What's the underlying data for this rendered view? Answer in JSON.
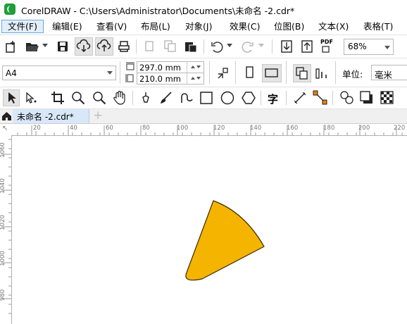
{
  "window": {
    "title": "CorelDRAW - C:\\Users\\Administrator\\Documents\\未命名 -2.cdr*"
  },
  "menu": [
    {
      "label": "文件(F)"
    },
    {
      "label": "编辑(E)"
    },
    {
      "label": "查看(V)"
    },
    {
      "label": "布局(L)"
    },
    {
      "label": "对象(J)"
    },
    {
      "label": "效果(C)"
    },
    {
      "label": "位图(B)"
    },
    {
      "label": "文本(X)"
    },
    {
      "label": "表格(T)"
    }
  ],
  "standard_toolbar": {
    "zoom_value": "68%",
    "pdf_label": "PDF"
  },
  "property_bar": {
    "page_size": "A4",
    "width": "297.0 mm",
    "height": "210.0 mm",
    "units_label": "单位:",
    "units_value": "毫米"
  },
  "toolbox": {
    "text_tool_glyph": "字"
  },
  "tabs": {
    "doc_tab_label": "未命名 -2.cdr*",
    "add_tab": "+"
  },
  "ruler": {
    "h_ticks": [
      "20",
      "40",
      "60",
      "80",
      "100",
      "120",
      "140",
      "160",
      "180",
      "200",
      "220"
    ],
    "v_ticks": [
      "1060",
      "1040",
      "1020",
      "1000",
      "980"
    ],
    "corner": "↖"
  },
  "canvas": {
    "shape": "pie-wedge",
    "fill": "#f5b400",
    "stroke": "#3a2a00"
  },
  "colors": {
    "menu_highlight": "#e3eefb",
    "menu_border": "#6aa7e0",
    "tab_active": "#d8e8f8"
  }
}
